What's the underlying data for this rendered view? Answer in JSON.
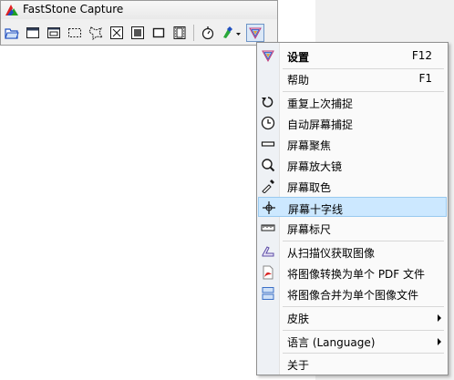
{
  "window": {
    "title": "FastStone Capture"
  },
  "toolbar": {
    "buttons": [
      "open-icon",
      "window-capture-icon",
      "object-capture-icon",
      "rectangle-capture-icon",
      "freehand-capture-icon",
      "fullscreen-capture-icon",
      "scrolling-capture-icon",
      "fixed-region-icon",
      "video-record-icon",
      "delay-timer-icon",
      "output-icon",
      "settings-logo-icon"
    ]
  },
  "menu": {
    "settings": {
      "label": "设置",
      "shortcut": "F12"
    },
    "help": {
      "label": "帮助",
      "shortcut": "F1"
    },
    "repeat": {
      "label": "重复上次捕捉"
    },
    "auto": {
      "label": "自动屏幕捕捉"
    },
    "focus": {
      "label": "屏幕聚焦"
    },
    "magnifier": {
      "label": "屏幕放大镜"
    },
    "colorpicker": {
      "label": "屏幕取色"
    },
    "crosshair": {
      "label": "屏幕十字线"
    },
    "ruler": {
      "label": "屏幕标尺"
    },
    "scanner": {
      "label": "从扫描仪获取图像"
    },
    "topdf": {
      "label": "将图像转换为单个 PDF 文件"
    },
    "merge": {
      "label": "将图像合并为单个图像文件"
    },
    "skin": {
      "label": "皮肤"
    },
    "language": {
      "label": "语言 (Language)"
    },
    "about": {
      "label": "关于"
    }
  },
  "colors": {
    "highlight": "#cce8ff",
    "highlight_border": "#99c9ef",
    "gutter": "#eef1f5"
  }
}
